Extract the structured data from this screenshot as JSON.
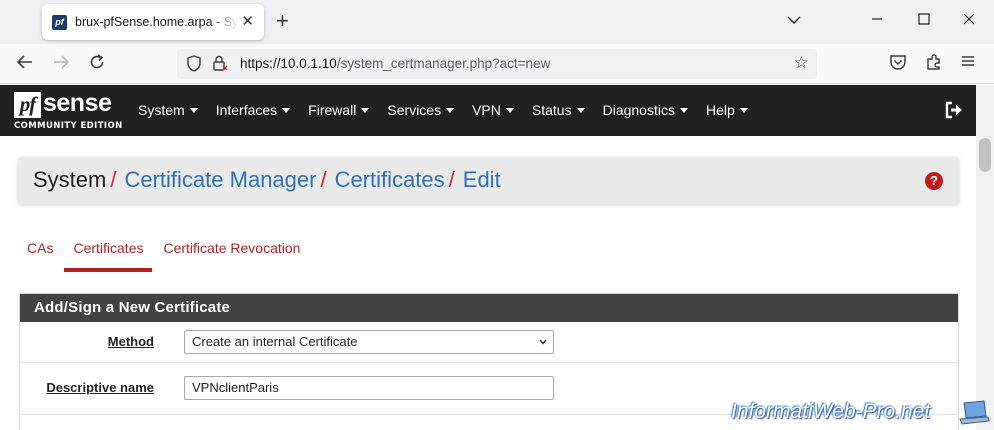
{
  "browser": {
    "tab_title": "brux-pfSense.home.arpa - System: Certificate Manager",
    "tab_favicon": "pf",
    "url_host": "https://10.0.1.10",
    "url_path": "/system_certmanager.php?act=new"
  },
  "pfsense": {
    "logo_pf": "pf",
    "logo_sense": "sense",
    "logo_edition": "COMMUNITY EDITION",
    "menu": [
      {
        "label": "System"
      },
      {
        "label": "Interfaces"
      },
      {
        "label": "Firewall"
      },
      {
        "label": "Services"
      },
      {
        "label": "VPN"
      },
      {
        "label": "Status"
      },
      {
        "label": "Diagnostics"
      },
      {
        "label": "Help"
      }
    ]
  },
  "breadcrumb": {
    "root": "System",
    "sep": "/",
    "items": [
      "Certificate Manager",
      "Certificates",
      "Edit"
    ],
    "help": "?"
  },
  "tabs": [
    {
      "label": "CAs",
      "active": false
    },
    {
      "label": "Certificates",
      "active": true
    },
    {
      "label": "Certificate Revocation",
      "active": false
    }
  ],
  "panel": {
    "title": "Add/Sign a New Certificate",
    "method_label": "Method",
    "method_value": "Create an internal Certificate",
    "descr_label": "Descriptive name",
    "descr_value": "VPNclientParis"
  },
  "watermark": "InformatiWeb-Pro.net",
  "colors": {
    "header_bg": "#212121",
    "link_blue": "#2e71b8",
    "accent_red": "#b22222",
    "panel_head": "#424242"
  }
}
